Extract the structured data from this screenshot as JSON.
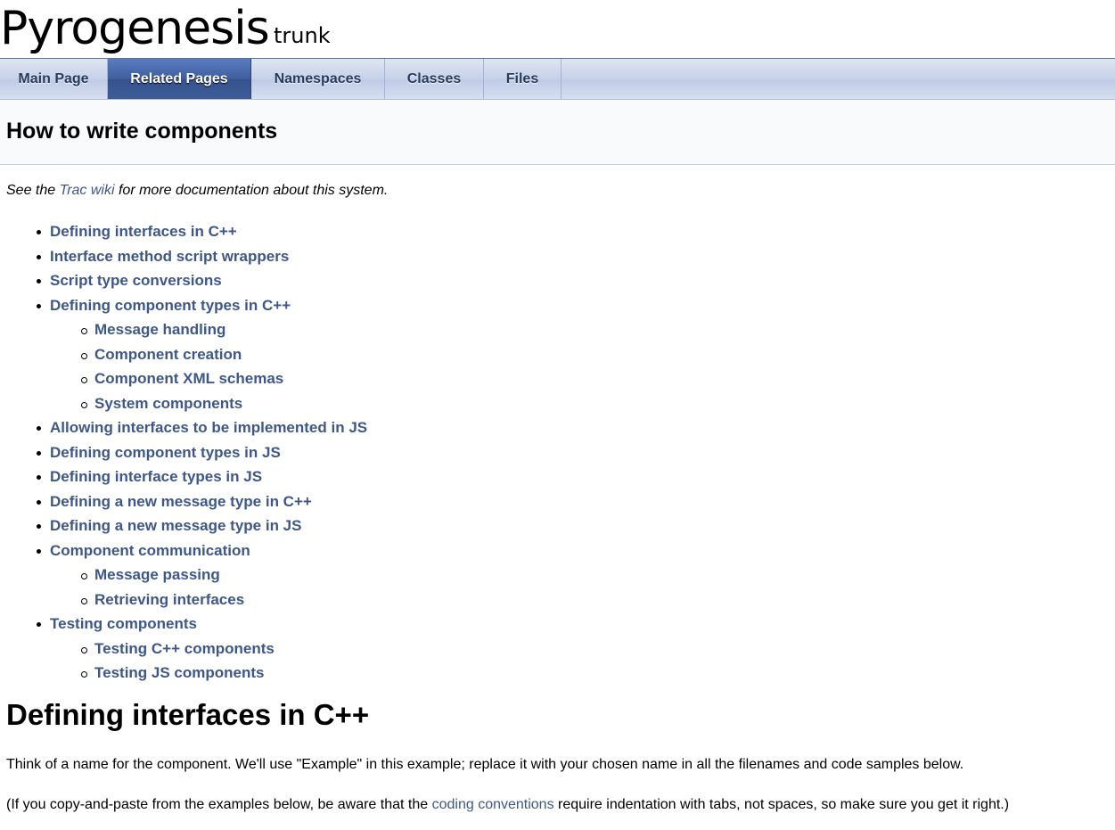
{
  "project": {
    "name": "Pyrogenesis",
    "number": "trunk"
  },
  "tabs": [
    {
      "label": "Main Page",
      "current": false
    },
    {
      "label": "Related Pages",
      "current": true
    },
    {
      "label": "Namespaces",
      "current": false
    },
    {
      "label": "Classes",
      "current": false
    },
    {
      "label": "Files",
      "current": false
    }
  ],
  "page": {
    "title": "How to write components",
    "intro": {
      "before": "See the ",
      "link": "Trac wiki",
      "after": " for more documentation about this system."
    }
  },
  "toc": [
    {
      "label": "Defining interfaces in C++",
      "level": 1
    },
    {
      "label": "Interface method script wrappers",
      "level": 1
    },
    {
      "label": "Script type conversions",
      "level": 1
    },
    {
      "label": "Defining component types in C++",
      "level": 1
    },
    {
      "label": "Message handling",
      "level": 2
    },
    {
      "label": "Component creation",
      "level": 2
    },
    {
      "label": "Component XML schemas",
      "level": 2
    },
    {
      "label": "System components",
      "level": 2
    },
    {
      "label": "Allowing interfaces to be implemented in JS",
      "level": 1
    },
    {
      "label": "Defining component types in JS",
      "level": 1
    },
    {
      "label": "Defining interface types in JS",
      "level": 1
    },
    {
      "label": "Defining a new message type in C++",
      "level": 1
    },
    {
      "label": "Defining a new message type in JS",
      "level": 1
    },
    {
      "label": "Component communication",
      "level": 1
    },
    {
      "label": "Message passing",
      "level": 2
    },
    {
      "label": "Retrieving interfaces",
      "level": 2
    },
    {
      "label": "Testing components",
      "level": 1
    },
    {
      "label": "Testing C++ components",
      "level": 2
    },
    {
      "label": "Testing JS components",
      "level": 2
    }
  ],
  "section": {
    "heading": "Defining interfaces in C++",
    "para1": "Think of a name for the component. We'll use \"Example\" in this example; replace it with your chosen name in all the filenames and code samples below.",
    "para2": {
      "before": "(If you copy-and-paste from the examples below, be aware that the ",
      "link": "coding conventions",
      "after": " require indentation with tabs, not spaces, so make sure you get it right.)"
    }
  }
}
